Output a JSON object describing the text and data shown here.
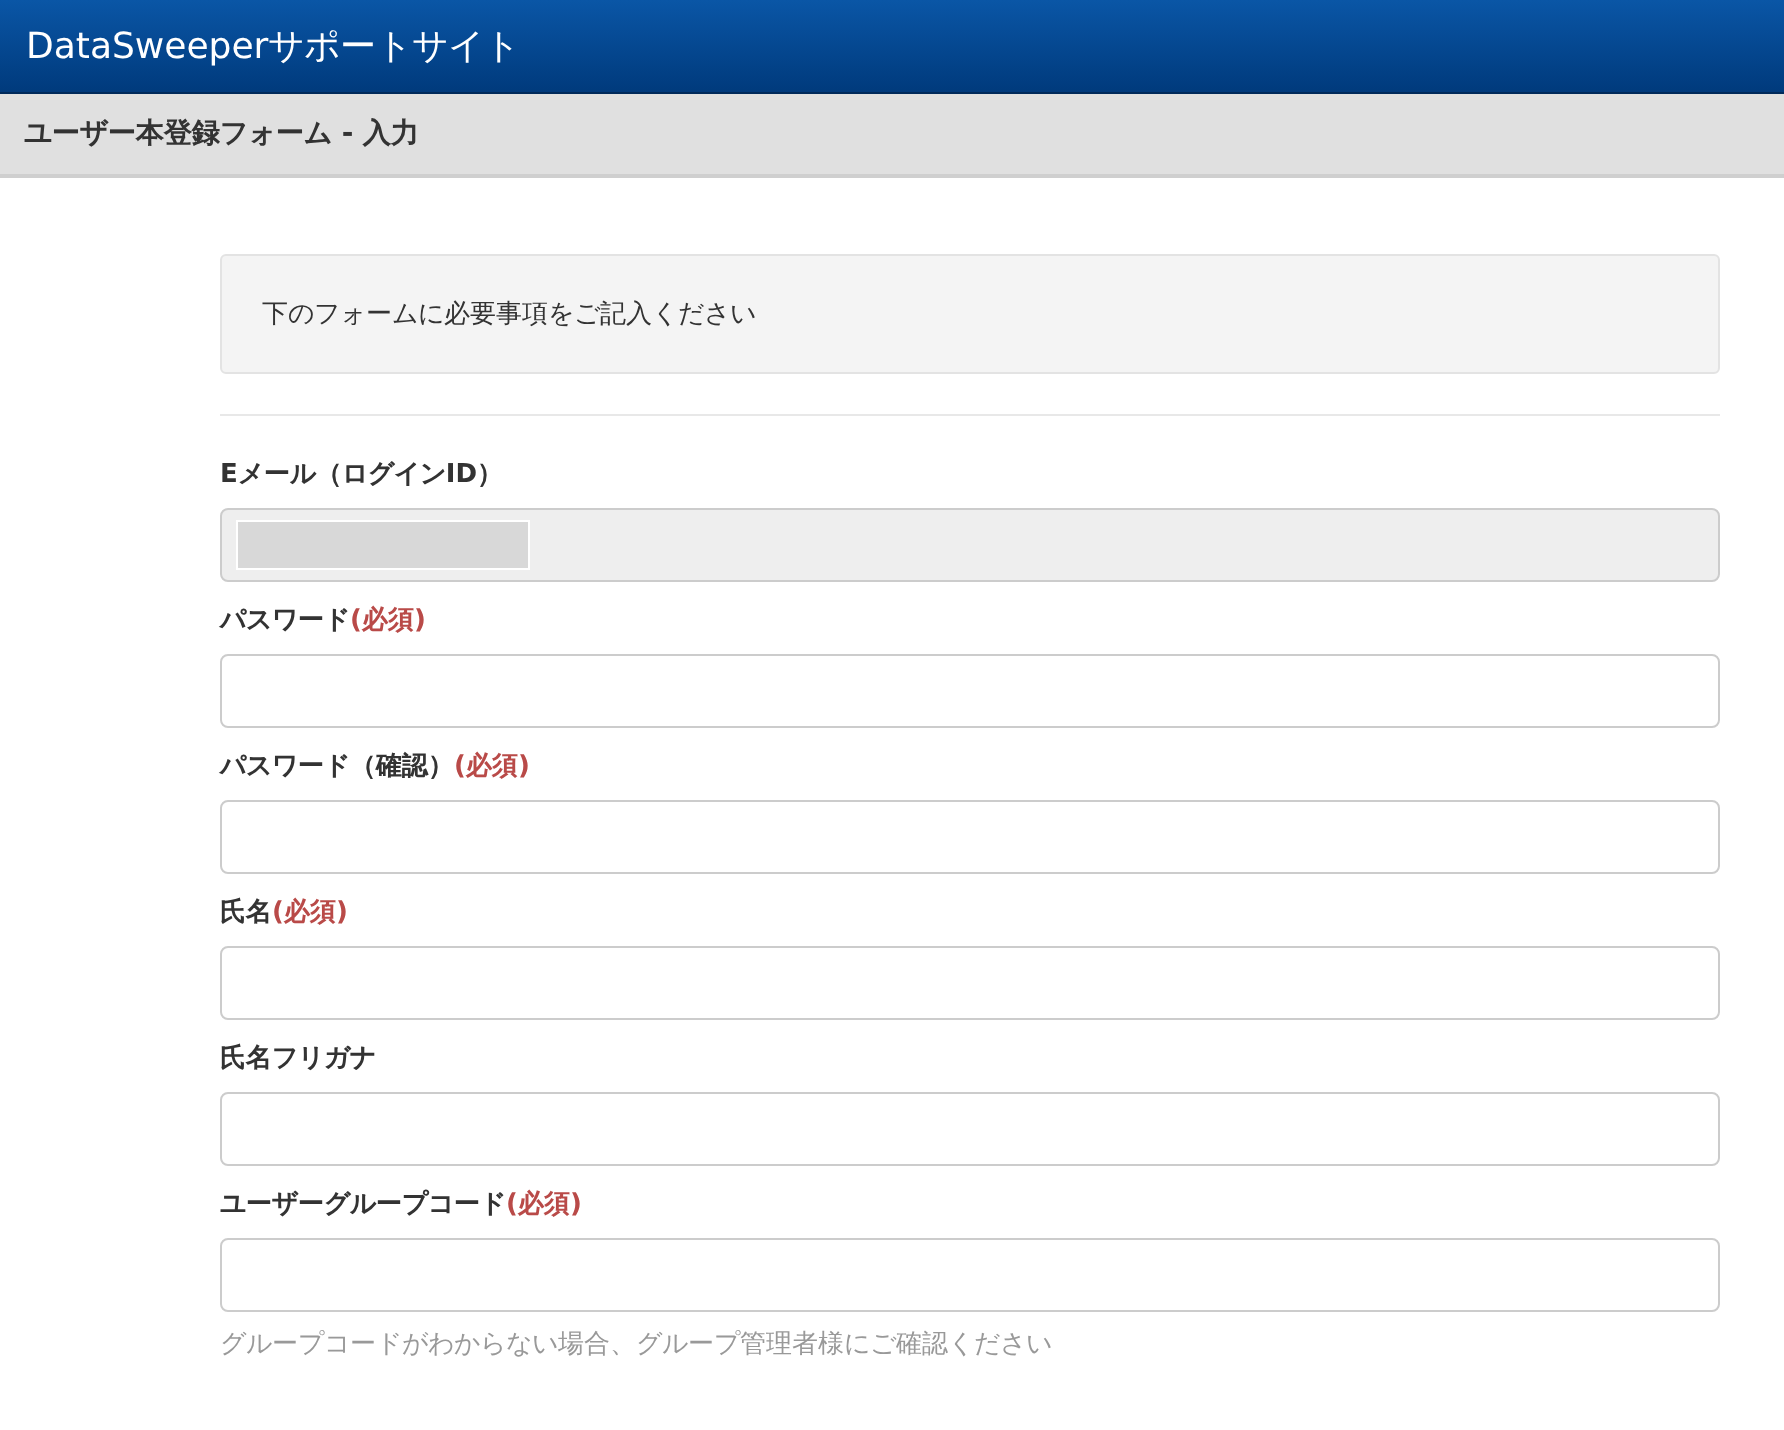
{
  "header": {
    "title": "DataSweeperサポートサイト"
  },
  "page_title": "ユーザー本登録フォーム - 入力",
  "notice": "下のフォームに必要事項をご記入ください",
  "fields": [
    {
      "label": "Eメール（ログインID）",
      "disabled": true,
      "redacted": true
    },
    {
      "label": "パスワード",
      "required_mark": "(必須)",
      "disabled": false
    },
    {
      "label": "パスワード（確認）",
      "required_mark": "(必須)",
      "disabled": false
    },
    {
      "label": "氏名",
      "required_mark": "(必須)",
      "disabled": false
    },
    {
      "label": "氏名フリガナ",
      "disabled": false
    },
    {
      "label": "ユーザーグループコード",
      "required_mark": "(必須)",
      "disabled": false,
      "help": "グループコードがわからない場合、グループ管理者様にご確認ください"
    }
  ]
}
